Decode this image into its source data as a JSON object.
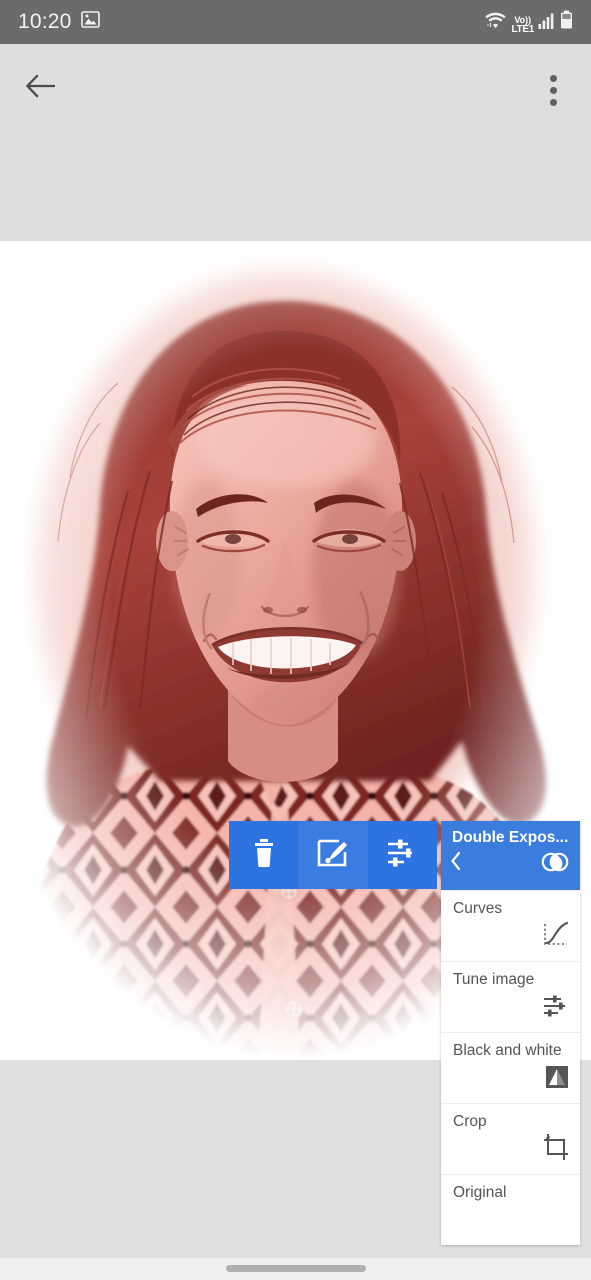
{
  "status_bar": {
    "clock": "10:20",
    "left_icons": [
      "image-icon"
    ],
    "network_label_top": "Vo))",
    "network_label_bottom": "LTE1",
    "right_icons": [
      "wifi-icon",
      "volte-icon",
      "signal-icon",
      "battery-icon"
    ],
    "background": "#6b6b6b"
  },
  "app_bar": {
    "back_icon": "arrow-left-icon",
    "overflow_icon": "more-vertical-icon",
    "background": "#dedede"
  },
  "photo": {
    "description": "Red duotone portrait of a smiling woman with curly hair wearing a diamond-patterned shirt",
    "tint_color": "#c7524a",
    "background": "#ffffff"
  },
  "edit_toolbar": {
    "accent": "#2d74e0",
    "buttons": [
      {
        "name": "delete",
        "icon": "trash-icon"
      },
      {
        "name": "edit",
        "icon": "brush-edit-icon"
      },
      {
        "name": "tune",
        "icon": "tune-sliders-icon"
      }
    ]
  },
  "looks_panel": {
    "header": {
      "title": "Double Expos...",
      "back_icon": "chevron-left-icon",
      "icon": "double-exposure-icon",
      "background": "#3b7ddd"
    },
    "items": [
      {
        "label": "Curves",
        "icon": "curves-icon"
      },
      {
        "label": "Tune image",
        "icon": "tune-sliders-icon"
      },
      {
        "label": "Black and white",
        "icon": "black-and-white-icon"
      },
      {
        "label": "Crop",
        "icon": "crop-icon"
      },
      {
        "label": "Original",
        "icon": ""
      }
    ]
  },
  "nav_bar": {
    "gesture_pill": "home-indicator"
  }
}
